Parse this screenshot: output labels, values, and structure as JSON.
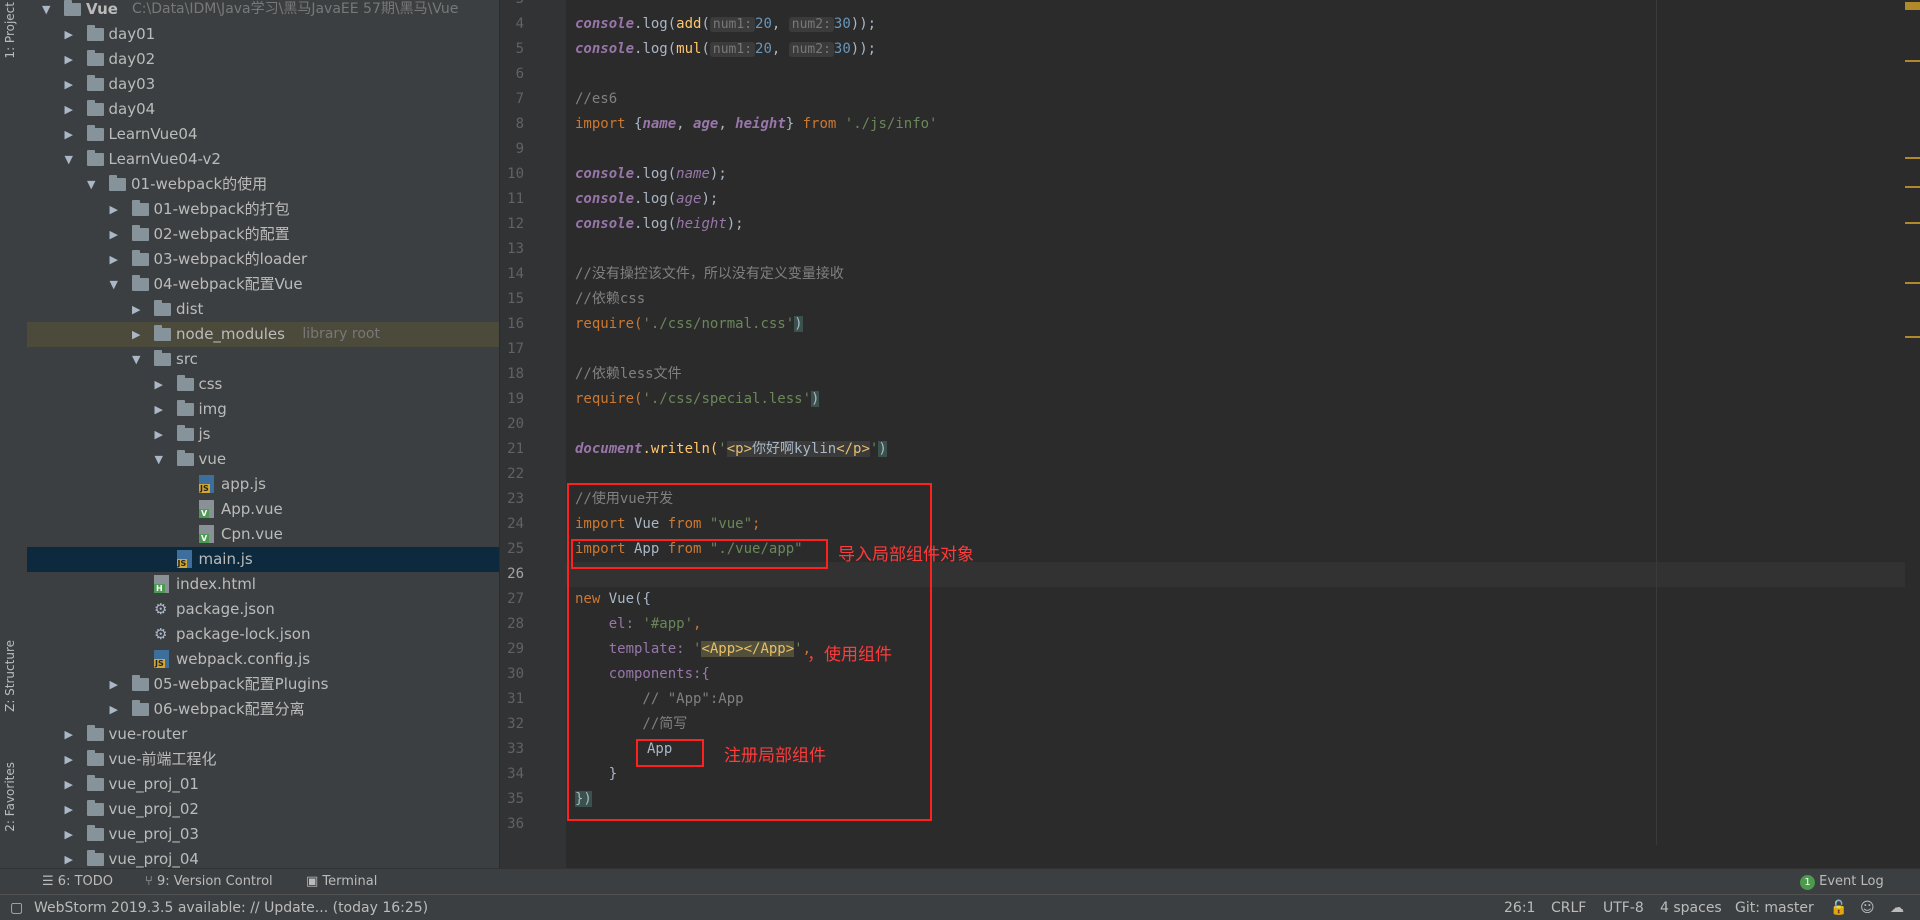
{
  "tool_strip": {
    "project_tab": "1: Project",
    "structure_tab": "Z: Structure",
    "favorites_tab": "2: Favorites"
  },
  "tree": [
    {
      "indent": 0,
      "arrow": "▼",
      "icon": "folder",
      "label": "Vue",
      "extra": "C:\\Data\\IDM\\Java学习\\黑马JavaEE 57期\\黑马\\Vue"
    },
    {
      "indent": 1,
      "arrow": "▶",
      "icon": "folder",
      "label": "day01"
    },
    {
      "indent": 1,
      "arrow": "▶",
      "icon": "folder",
      "label": "day02"
    },
    {
      "indent": 1,
      "arrow": "▶",
      "icon": "folder",
      "label": "day03"
    },
    {
      "indent": 1,
      "arrow": "▶",
      "icon": "folder",
      "label": "day04"
    },
    {
      "indent": 1,
      "arrow": "▶",
      "icon": "folder",
      "label": "LearnVue04"
    },
    {
      "indent": 1,
      "arrow": "▼",
      "icon": "folder",
      "label": "LearnVue04-v2"
    },
    {
      "indent": 2,
      "arrow": "▼",
      "icon": "folder",
      "label": "01-webpack的使用"
    },
    {
      "indent": 3,
      "arrow": "▶",
      "icon": "folder",
      "label": "01-webpack的打包"
    },
    {
      "indent": 3,
      "arrow": "▶",
      "icon": "folder",
      "label": "02-webpack的配置"
    },
    {
      "indent": 3,
      "arrow": "▶",
      "icon": "folder",
      "label": "03-webpack的loader"
    },
    {
      "indent": 3,
      "arrow": "▼",
      "icon": "folder",
      "label": "04-webpack配置Vue"
    },
    {
      "indent": 4,
      "arrow": "▶",
      "icon": "folder",
      "label": "dist"
    },
    {
      "indent": 4,
      "arrow": "▶",
      "icon": "folder",
      "label": "node_modules",
      "extra": "library root",
      "highlight": true
    },
    {
      "indent": 4,
      "arrow": "▼",
      "icon": "folder",
      "label": "src"
    },
    {
      "indent": 5,
      "arrow": "▶",
      "icon": "folder",
      "label": "css"
    },
    {
      "indent": 5,
      "arrow": "▶",
      "icon": "folder",
      "label": "img"
    },
    {
      "indent": 5,
      "arrow": "▶",
      "icon": "folder",
      "label": "js"
    },
    {
      "indent": 5,
      "arrow": "▼",
      "icon": "folder",
      "label": "vue"
    },
    {
      "indent": 6,
      "arrow": "",
      "icon": "js",
      "label": "app.js"
    },
    {
      "indent": 6,
      "arrow": "",
      "icon": "vue",
      "label": "App.vue"
    },
    {
      "indent": 6,
      "arrow": "",
      "icon": "vue",
      "label": "Cpn.vue"
    },
    {
      "indent": 5,
      "arrow": "",
      "icon": "js",
      "label": "main.js",
      "selected": true
    },
    {
      "indent": 4,
      "arrow": "",
      "icon": "html",
      "label": "index.html"
    },
    {
      "indent": 4,
      "arrow": "",
      "icon": "gear",
      "label": "package.json"
    },
    {
      "indent": 4,
      "arrow": "",
      "icon": "gear",
      "label": "package-lock.json"
    },
    {
      "indent": 4,
      "arrow": "",
      "icon": "js",
      "label": "webpack.config.js"
    },
    {
      "indent": 3,
      "arrow": "▶",
      "icon": "folder",
      "label": "05-webpack配置Plugins"
    },
    {
      "indent": 3,
      "arrow": "▶",
      "icon": "folder",
      "label": "06-webpack配置分离"
    },
    {
      "indent": 1,
      "arrow": "▶",
      "icon": "folder",
      "label": "vue-router"
    },
    {
      "indent": 1,
      "arrow": "▶",
      "icon": "folder",
      "label": "vue-前端工程化"
    },
    {
      "indent": 1,
      "arrow": "▶",
      "icon": "folder",
      "label": "vue_proj_01"
    },
    {
      "indent": 1,
      "arrow": "▶",
      "icon": "folder",
      "label": "vue_proj_02"
    },
    {
      "indent": 1,
      "arrow": "▶",
      "icon": "folder",
      "label": "vue_proj_03"
    },
    {
      "indent": 1,
      "arrow": "▶",
      "icon": "folder",
      "label": "vue_proj_04"
    }
  ],
  "editor": {
    "line_numbers": [
      "3",
      "4",
      "5",
      "6",
      "7",
      "8",
      "9",
      "10",
      "11",
      "12",
      "13",
      "14",
      "15",
      "16",
      "17",
      "18",
      "19",
      "20",
      "21",
      "22",
      "23",
      "24",
      "25",
      "26",
      "27",
      "28",
      "29",
      "30",
      "31",
      "32",
      "33",
      "34",
      "35",
      "36"
    ],
    "current_line": "26",
    "lines": {
      "l4_a": "console",
      "l4_b": ".log(",
      "l4_c": "add",
      "l4_d": "(",
      "l4_hint1": "num1:",
      "l4_v1": "20",
      "l4_sep": ", ",
      "l4_hint2": "num2:",
      "l4_v2": "30",
      "l4_e": "));",
      "l5_a": "console",
      "l5_b": ".log(",
      "l5_c": "mul",
      "l5_d": "(",
      "l5_hint1": "num1:",
      "l5_v1": "20",
      "l5_sep": ", ",
      "l5_hint2": "num2:",
      "l5_v2": "30",
      "l5_e": "));",
      "l7": "//es6",
      "l8_kw": "import",
      "l8_a": " {",
      "l8_name": "name",
      "l8_c1": ", ",
      "l8_age": "age",
      "l8_c2": ", ",
      "l8_height": "height",
      "l8_b": "} ",
      "l8_from": "from",
      "l8_sp": " ",
      "l8_str": "'./js/info'",
      "l10_a": "console",
      "l10_b": ".log(",
      "l10_v": "name",
      "l10_e": ");",
      "l11_a": "console",
      "l11_b": ".log(",
      "l11_v": "age",
      "l11_e": ");",
      "l12_a": "console",
      "l12_b": ".log(",
      "l12_v": "height",
      "l12_e": ");",
      "l14": "//没有操控该文件，所以没有定义变量接收",
      "l15": "//依赖css",
      "l16_a": "require(",
      "l16_s": "'./css/normal.css'",
      "l16_e": ")",
      "l18": "//依赖less文件",
      "l19_a": "require(",
      "l19_s": "'./css/special.less'",
      "l19_e": ")",
      "l21_a": "document",
      "l21_b": ".writeln(",
      "l21_q1": "'",
      "l21_t1": "<p>",
      "l21_txt": "你好啊kylin",
      "l21_t2": "</p>",
      "l21_q2": "'",
      "l21_e": ")",
      "l23": "//使用vue开发",
      "l24_kw": "import",
      "l24_a": " Vue ",
      "l24_from": "from",
      "l24_sp": " ",
      "l24_str": "\"vue\"",
      "l24_e": ";",
      "l25_kw": "import",
      "l25_a": " App ",
      "l25_from": "from",
      "l25_sp": " ",
      "l25_str": "\"./vue/app\"",
      "l27_kw": "new",
      "l27_a": " Vue({",
      "l28_a": "    el: ",
      "l28_s": "'#app'",
      "l28_e": ",",
      "l29_a": "    template: ",
      "l29_q1": "'",
      "l29_t": "<App></App>",
      "l29_q2": "'",
      "l29_e": ",",
      "l30_a": "    components:{",
      "l31": "        // \"App\":App",
      "l32": "        //简写",
      "l33": "App",
      "l34": "    }",
      "l35_a": "})"
    }
  },
  "annotations": {
    "import_note": "导入局部组件对象",
    "template_note": "，使用组件",
    "register_note": "注册局部组件"
  },
  "bottom_tabs": {
    "todo": "6: TODO",
    "vcs": "9: Version Control",
    "terminal": "Terminal",
    "event_log_badge": "1",
    "event_log": "Event Log"
  },
  "status_bar": {
    "message": "WebStorm 2019.3.5 available: // Update... (today 16:25)",
    "position": "26:1",
    "line_sep": "CRLF",
    "encoding": "UTF-8",
    "indent": "4 spaces",
    "git": "Git: master"
  }
}
